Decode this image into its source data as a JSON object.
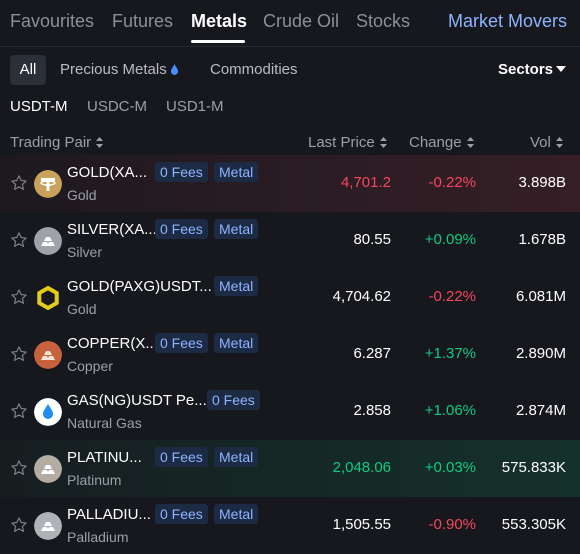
{
  "nav": {
    "tabs": [
      "Favourites",
      "Futures",
      "Metals",
      "Crude Oil",
      "Stocks"
    ],
    "active": "Metals",
    "market_movers": "Market Movers"
  },
  "subnav": {
    "all": "All",
    "precious": "Precious Metals",
    "commodities": "Commodities",
    "sectors": "Sectors"
  },
  "quotes": [
    "USDT-M",
    "USDC-M",
    "USD1-M"
  ],
  "headers": {
    "pair": "Trading Pair",
    "price": "Last Price",
    "change": "Change",
    "vol": "Vol"
  },
  "rows": [
    {
      "name": "GOLD(XA...",
      "sub": "Gold",
      "fees": "0 Fees",
      "tag": "Metal",
      "price": "4,701.2",
      "change": "-0.22%",
      "vol": "3.898B",
      "coin": "usdt-icon"
    },
    {
      "name": "SILVER(XA...",
      "sub": "Silver",
      "fees": "0 Fees",
      "tag": "Metal",
      "price": "80.55",
      "change": "+0.09%",
      "vol": "1.678B",
      "coin": "silver-bars-icon"
    },
    {
      "name": "GOLD(PAXG)USDT...",
      "sub": "Gold",
      "fees": "",
      "tag": "Metal",
      "price": "4,704.62",
      "change": "-0.22%",
      "vol": "6.081M",
      "coin": "paxg-icon"
    },
    {
      "name": "COPPER(X...",
      "sub": "Copper",
      "fees": "0 Fees",
      "tag": "Metal",
      "price": "6.287",
      "change": "+1.37%",
      "vol": "2.890M",
      "coin": "copper-bars-icon"
    },
    {
      "name": "GAS(NG)USDT Pe...",
      "sub": "Natural Gas",
      "fees": "0 Fees",
      "tag": "",
      "price": "2.858",
      "change": "+1.06%",
      "vol": "2.874M",
      "coin": "gas-drop-icon"
    },
    {
      "name": "PLATINU...",
      "sub": "Platinum",
      "fees": "0 Fees",
      "tag": "Metal",
      "price": "2,048.06",
      "change": "+0.03%",
      "vol": "575.833K",
      "coin": "platinum-bars-icon"
    },
    {
      "name": "PALLADIU...",
      "sub": "Palladium",
      "fees": "0 Fees",
      "tag": "Metal",
      "price": "1,505.55",
      "change": "-0.90%",
      "vol": "553.305K",
      "coin": "palladium-bars-icon"
    }
  ],
  "colors": {
    "up": "#0ecb81",
    "down": "#f6465d",
    "accent": "#8db4ff"
  }
}
